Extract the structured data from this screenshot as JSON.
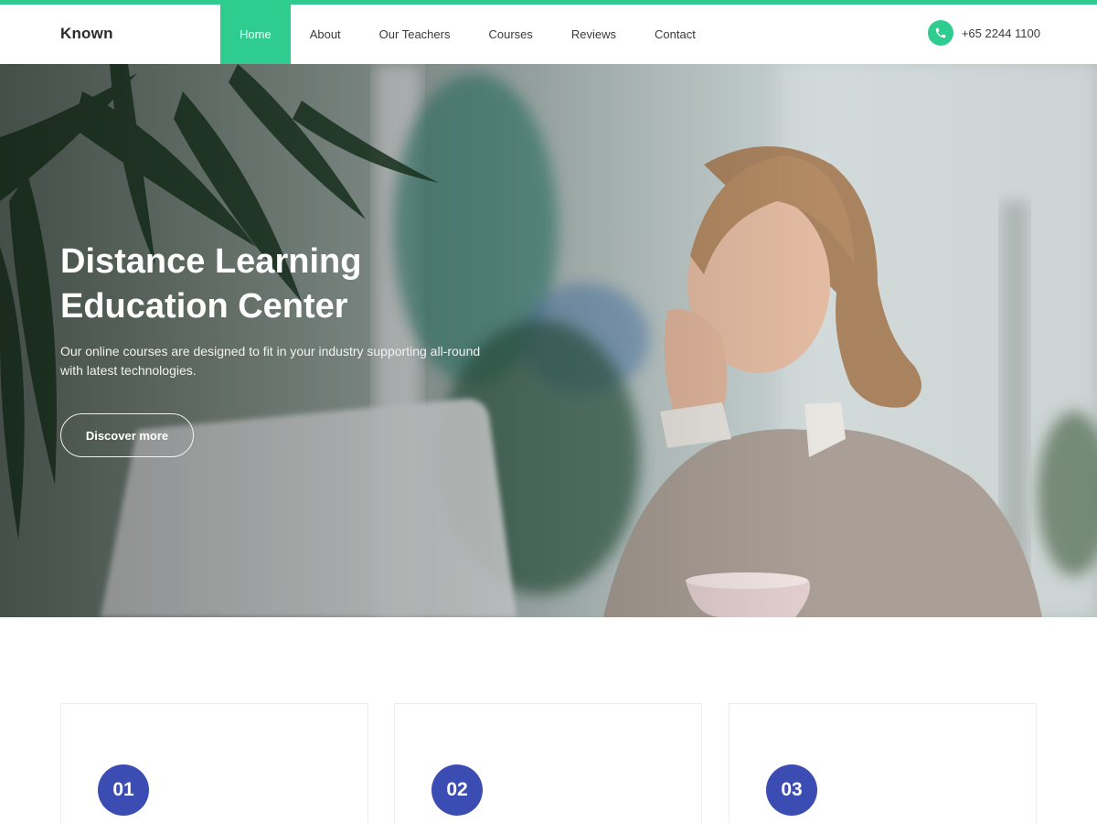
{
  "brand": {
    "name": "Known",
    "accent_color": "#2ecc8f",
    "badge_color": "#3b4db3"
  },
  "nav": {
    "items": [
      {
        "label": "Home",
        "active": true
      },
      {
        "label": "About",
        "active": false
      },
      {
        "label": "Our Teachers",
        "active": false
      },
      {
        "label": "Courses",
        "active": false
      },
      {
        "label": "Reviews",
        "active": false
      },
      {
        "label": "Contact",
        "active": false
      }
    ]
  },
  "contact": {
    "phone": "+65 2244 1100",
    "icon": "phone-icon"
  },
  "hero": {
    "title_line1": "Distance Learning",
    "title_line2": "Education Center",
    "subtitle_line1": "Our online courses are designed to fit in your industry supporting all-round",
    "subtitle_line2": "with latest technologies.",
    "button_label": "Discover more"
  },
  "features": {
    "cards": [
      {
        "number": "01"
      },
      {
        "number": "02"
      },
      {
        "number": "03"
      }
    ]
  }
}
